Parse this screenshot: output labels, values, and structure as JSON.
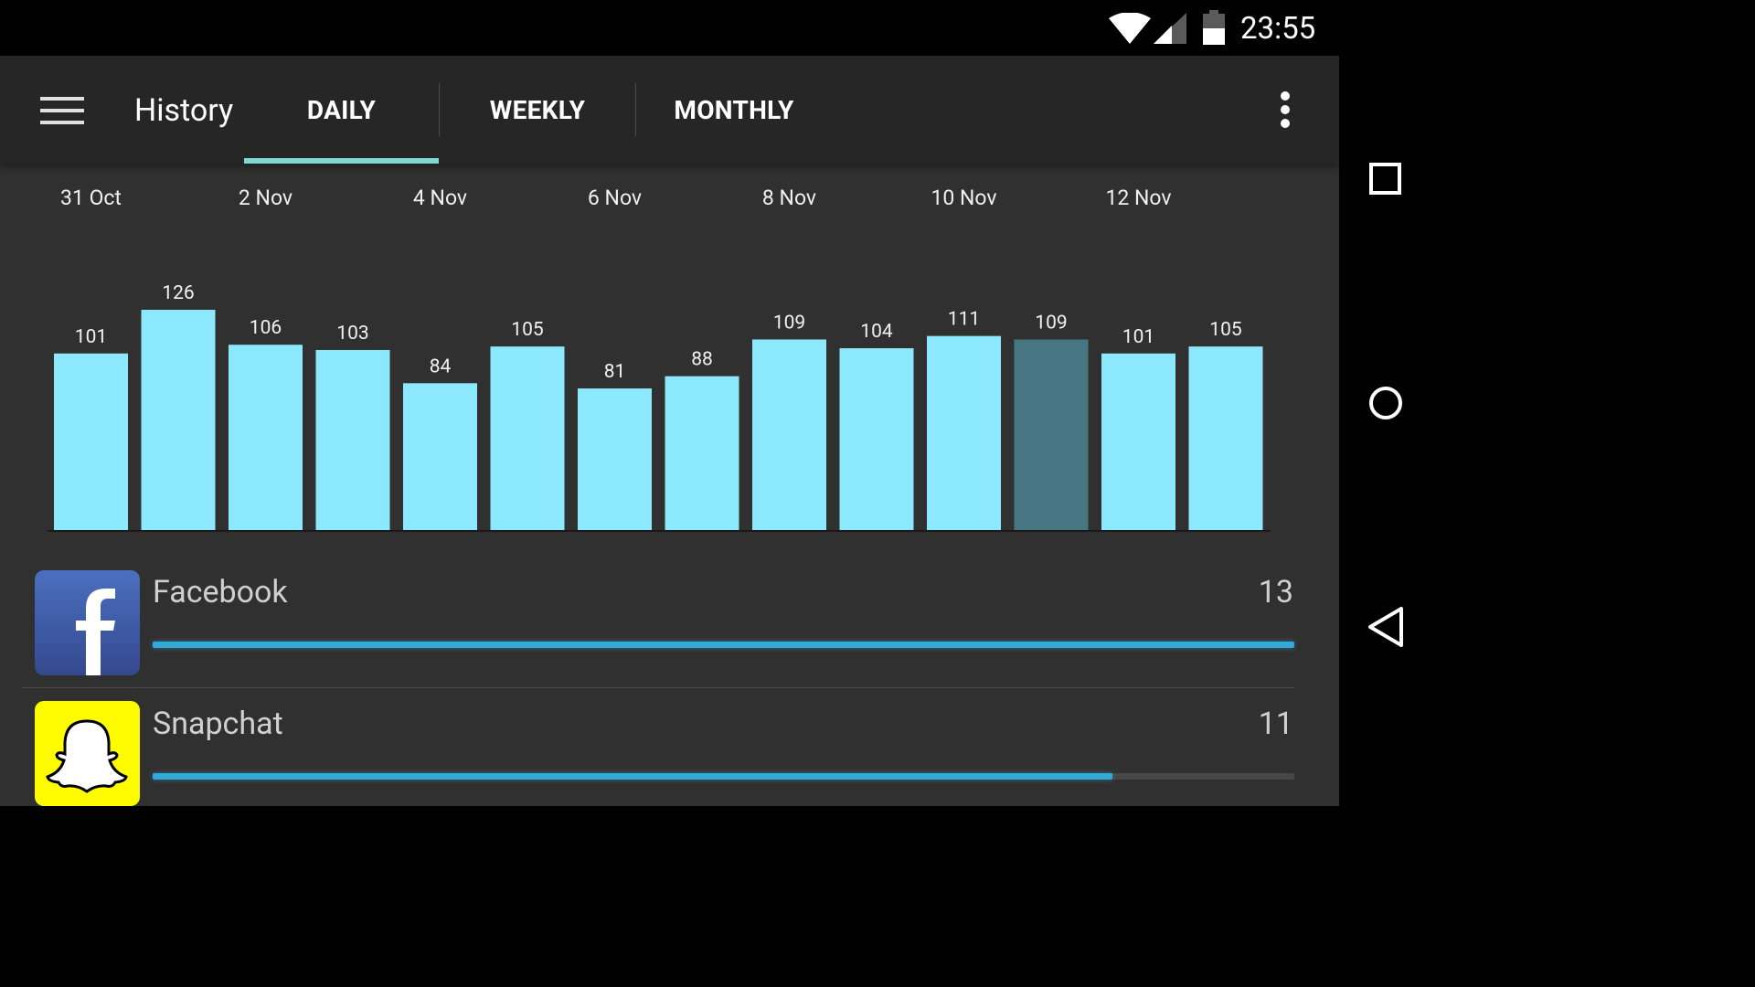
{
  "status_bar": {
    "time": "23:55",
    "icons": [
      "wifi-icon",
      "cell-signal-icon",
      "battery-icon"
    ]
  },
  "toolbar": {
    "menu_icon": "menu-icon",
    "title": "History",
    "tabs": [
      {
        "label": "DAILY",
        "selected": true
      },
      {
        "label": "WEEKLY",
        "selected": false
      },
      {
        "label": "MONTHLY",
        "selected": false
      }
    ],
    "overflow_icon": "more-vert-icon",
    "indicator_color": "#7dd8d0"
  },
  "chart_data": {
    "type": "bar",
    "date_labels": [
      "31 Oct",
      "2 Nov",
      "4 Nov",
      "6 Nov",
      "8 Nov",
      "10 Nov",
      "12 Nov"
    ],
    "values": [
      101,
      126,
      106,
      103,
      84,
      105,
      81,
      88,
      109,
      104,
      111,
      109,
      101,
      105
    ],
    "highlighted_index": 11,
    "bar_color": "#8ce9fd",
    "highlight_color": "#467682"
  },
  "apps": [
    {
      "name": "Facebook",
      "count": "13",
      "progress": 1.0,
      "icon": "facebook-icon",
      "icon_color": "#3b5998"
    },
    {
      "name": "Snapchat",
      "count": "11",
      "progress": 0.841,
      "icon": "snapchat-ghost-icon",
      "icon_color": "#fffc00"
    }
  ],
  "progress_color": "#33a9d9",
  "nav_bar": {
    "icons": [
      "recents-square-icon",
      "home-circle-icon",
      "back-triangle-icon"
    ]
  }
}
